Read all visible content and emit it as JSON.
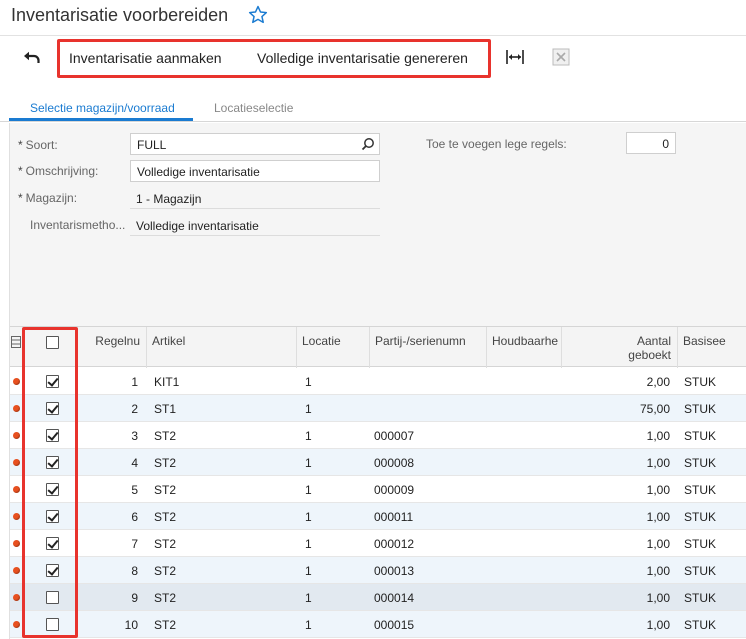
{
  "page": {
    "title": "Inventarisatie voorbereiden"
  },
  "toolbar": {
    "create_label": "Inventarisatie aanmaken",
    "generate_label": "Volledige inventarisatie genereren"
  },
  "tabs": [
    {
      "label": "Selectie magazijn/voorraad",
      "active": true
    },
    {
      "label": "Locatieselectie",
      "active": false
    }
  ],
  "form": {
    "soort": {
      "label": "Soort:",
      "value": "FULL",
      "required": "*"
    },
    "omschrijving": {
      "label": "Omschrijving:",
      "value": "Volledige inventarisatie",
      "required": "*"
    },
    "magazijn": {
      "label": "Magazijn:",
      "value": "1 - Magazijn",
      "required": "*"
    },
    "methode": {
      "label": "Inventarismetho...",
      "value": "Volledige inventarisatie"
    },
    "lege_regels": {
      "label": "Toe te voegen lege regels:",
      "value": "0"
    }
  },
  "grid": {
    "headers": {
      "regelnr": "Regelnu",
      "artikel": "Artikel",
      "locatie": "Locatie",
      "partij": "Partij-/serienumn",
      "houdbaar": "Houdbaarhe",
      "aantal_line1": "Aantal",
      "aantal_line2": "geboekt",
      "basis": "Basisee"
    },
    "rows": [
      {
        "nr": "1",
        "artikel": "KIT1",
        "locatie": "1",
        "partij": "",
        "aantal": "2,00",
        "eenheid": "STUK",
        "checked": true
      },
      {
        "nr": "2",
        "artikel": "ST1",
        "locatie": "1",
        "partij": "",
        "aantal": "75,00",
        "eenheid": "STUK",
        "checked": true
      },
      {
        "nr": "3",
        "artikel": "ST2",
        "locatie": "1",
        "partij": "000007",
        "aantal": "1,00",
        "eenheid": "STUK",
        "checked": true
      },
      {
        "nr": "4",
        "artikel": "ST2",
        "locatie": "1",
        "partij": "000008",
        "aantal": "1,00",
        "eenheid": "STUK",
        "checked": true
      },
      {
        "nr": "5",
        "artikel": "ST2",
        "locatie": "1",
        "partij": "000009",
        "aantal": "1,00",
        "eenheid": "STUK",
        "checked": true
      },
      {
        "nr": "6",
        "artikel": "ST2",
        "locatie": "1",
        "partij": "000011",
        "aantal": "1,00",
        "eenheid": "STUK",
        "checked": true
      },
      {
        "nr": "7",
        "artikel": "ST2",
        "locatie": "1",
        "partij": "000012",
        "aantal": "1,00",
        "eenheid": "STUK",
        "checked": true
      },
      {
        "nr": "8",
        "artikel": "ST2",
        "locatie": "1",
        "partij": "000013",
        "aantal": "1,00",
        "eenheid": "STUK",
        "checked": true
      },
      {
        "nr": "9",
        "artikel": "ST2",
        "locatie": "1",
        "partij": "000014",
        "aantal": "1,00",
        "eenheid": "STUK",
        "checked": false
      },
      {
        "nr": "10",
        "artikel": "ST2",
        "locatie": "1",
        "partij": "000015",
        "aantal": "1,00",
        "eenheid": "STUK",
        "checked": false
      }
    ]
  },
  "colors": {
    "accent": "#1a7bd1",
    "highlight": "#e8332d",
    "status_dot": "#e8501f"
  }
}
